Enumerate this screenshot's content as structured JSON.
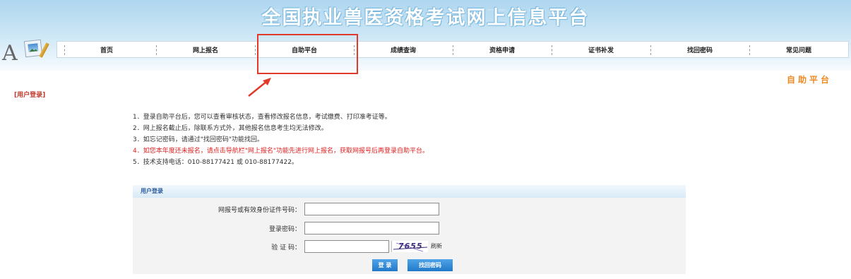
{
  "header": {
    "site_title": "全国执业兽医资格考试网上信息平台"
  },
  "nav": {
    "items": [
      {
        "label": "首页"
      },
      {
        "label": "网上报名"
      },
      {
        "label": "自助平台"
      },
      {
        "label": "成绩查询"
      },
      {
        "label": "资格申请"
      },
      {
        "label": "证书补发"
      },
      {
        "label": "找回密码"
      },
      {
        "label": "常见问题"
      }
    ]
  },
  "page_label": "自助平台",
  "side_label": "[用户登录]",
  "notes": [
    "1．登录自助平台后，您可以查看审核状态，查看修改报名信息，考试缴费、打印准考证等。",
    "2．网上报名截止后，除联系方式外，其他报名信息考生均无法修改。",
    "3．如忘记密码，请通过\"找回密码\"功能找回。",
    "4．如您本年度还未报名，请点击导航栏\"网上报名\"功能先进行网上报名，获取网报号后再登录自助平台。",
    "5．技术支持电话：010-88177421 或 010-88177422。"
  ],
  "colors": {
    "accent_red": "#e02020",
    "page_label": "#ee8a24",
    "button_blue": "#2f8ad8",
    "annotation_red": "#e23a2a"
  },
  "login": {
    "heading": "用户登录",
    "id_label": "网报号或有效身份证件号码：",
    "id_value": "",
    "password_label": "登录密码：",
    "password_value": "",
    "captcha_label": "验 证 码：",
    "captcha_value": "",
    "captcha_text": "7655",
    "refresh_label": "刷新",
    "login_button": "登 录",
    "recover_button": "找回密码"
  }
}
